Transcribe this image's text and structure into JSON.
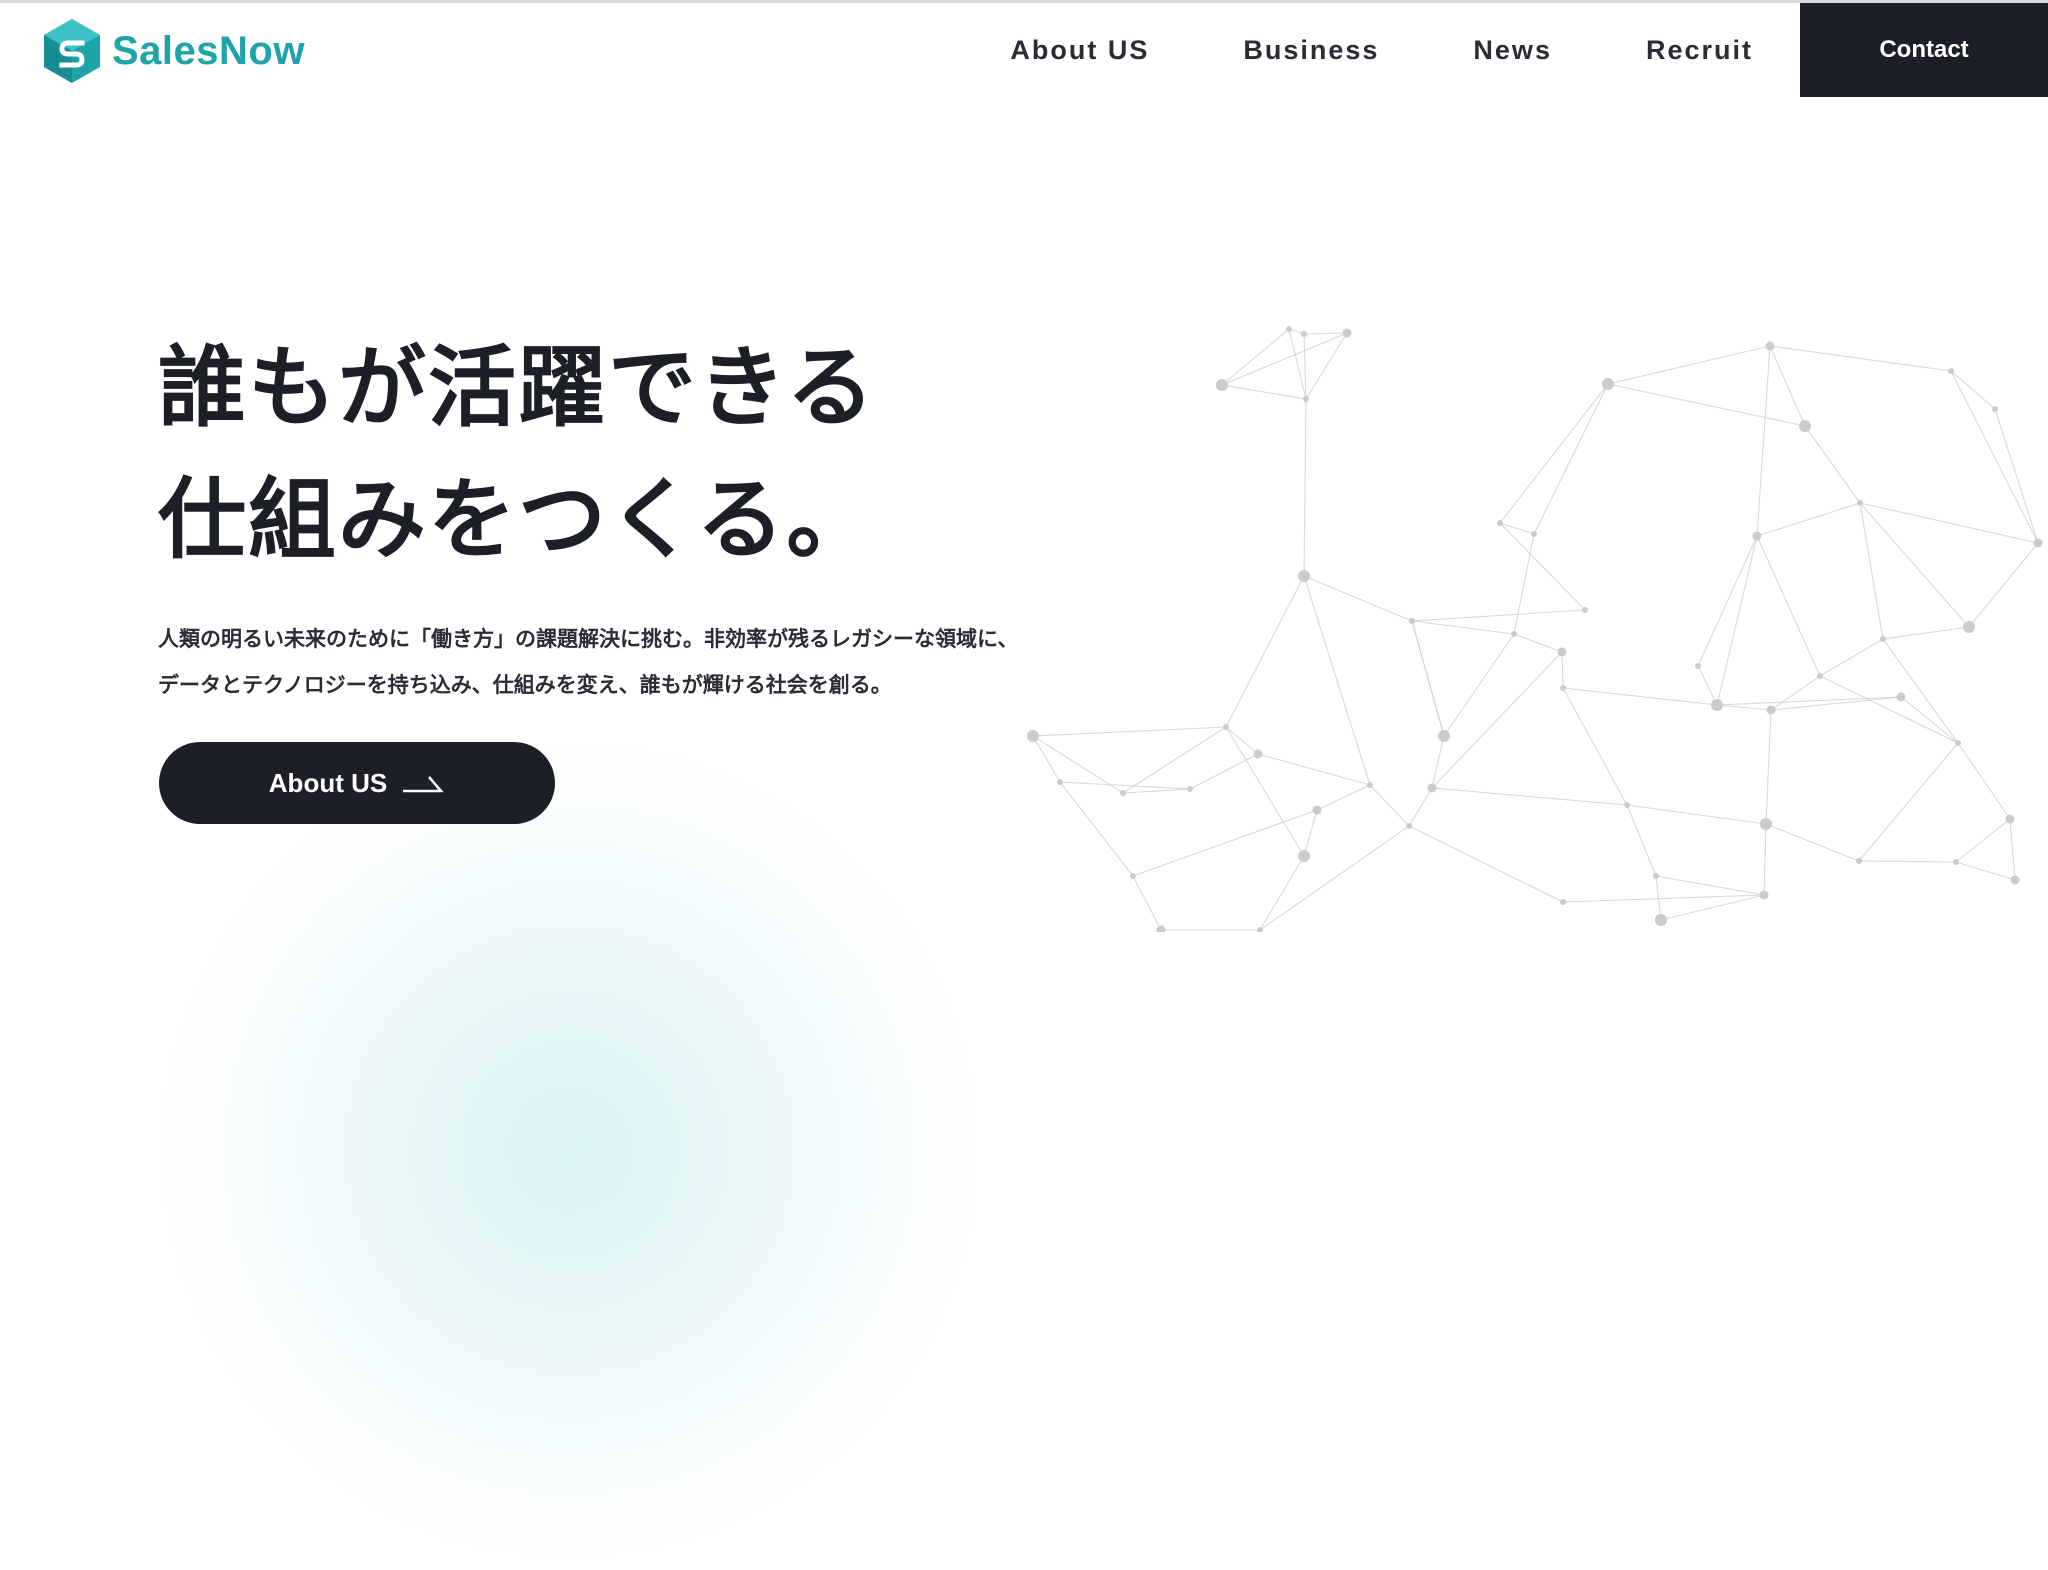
{
  "brand": {
    "name": "SalesNow",
    "color": "#1ea3a8",
    "icon": "hexagon-s-logo-icon"
  },
  "nav": {
    "items": [
      {
        "label": "About US"
      },
      {
        "label": "Business"
      },
      {
        "label": "News"
      },
      {
        "label": "Recruit"
      }
    ],
    "contact_label": "Contact"
  },
  "hero": {
    "title_line1": "誰もが活躍できる",
    "title_line2": "仕組みをつくる。",
    "desc_line1": "人類の明るい未来のために「働き方」の課題解決に挑む。非効率が残るレガシーな領域に、",
    "desc_line2": "データとテクノロジーを持ち込み、仕組みを変え、誰もが輝ける社会を創る。",
    "cta_label": "About US",
    "cta_icon": "arrow-right-icon"
  },
  "colors": {
    "dark": "#1c1f26",
    "accent": "#1ea3a8",
    "network": "#c9cbce"
  }
}
